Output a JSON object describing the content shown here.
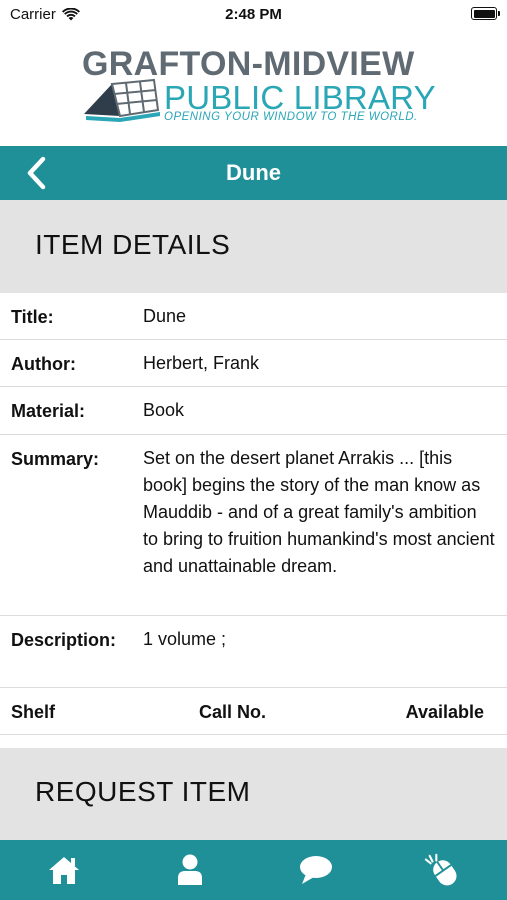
{
  "status_bar": {
    "carrier": "Carrier",
    "time": "2:48 PM"
  },
  "logo": {
    "line1": "GRAFTON-MIDVIEW",
    "line2": "PUBLIC LIBRARY",
    "tagline": "OPENING YOUR WINDOW TO THE WORLD."
  },
  "nav": {
    "title": "Dune",
    "back_icon": "chevron-left-icon"
  },
  "sections": {
    "details": "ITEM DETAILS",
    "request": "REQUEST ITEM"
  },
  "details": {
    "title": {
      "label": "Title:",
      "value": "Dune"
    },
    "author": {
      "label": "Author:",
      "value": "Herbert, Frank"
    },
    "material": {
      "label": "Material:",
      "value": "Book"
    },
    "summary": {
      "label": "Summary:",
      "value": "Set on the desert planet Arrakis ... [this book] begins the story of the man know as Mauddib - and of a great family's ambition to bring to fruition humankind's most ancient and unattainable dream."
    },
    "description": {
      "label": "Description:",
      "value": "1 volume ;"
    }
  },
  "holdings": {
    "columns": [
      "Shelf",
      "Call No.",
      "Available"
    ]
  },
  "tab_bar": {
    "tabs": [
      {
        "icon": "home-icon"
      },
      {
        "icon": "user-icon"
      },
      {
        "icon": "chat-bubble-icon"
      },
      {
        "icon": "mouse-click-icon"
      }
    ]
  },
  "colors": {
    "teal": "#1f8f98",
    "logo_teal": "#2aa6b6",
    "logo_gray": "#5f6a72",
    "section_bg": "#e3e3e3"
  }
}
